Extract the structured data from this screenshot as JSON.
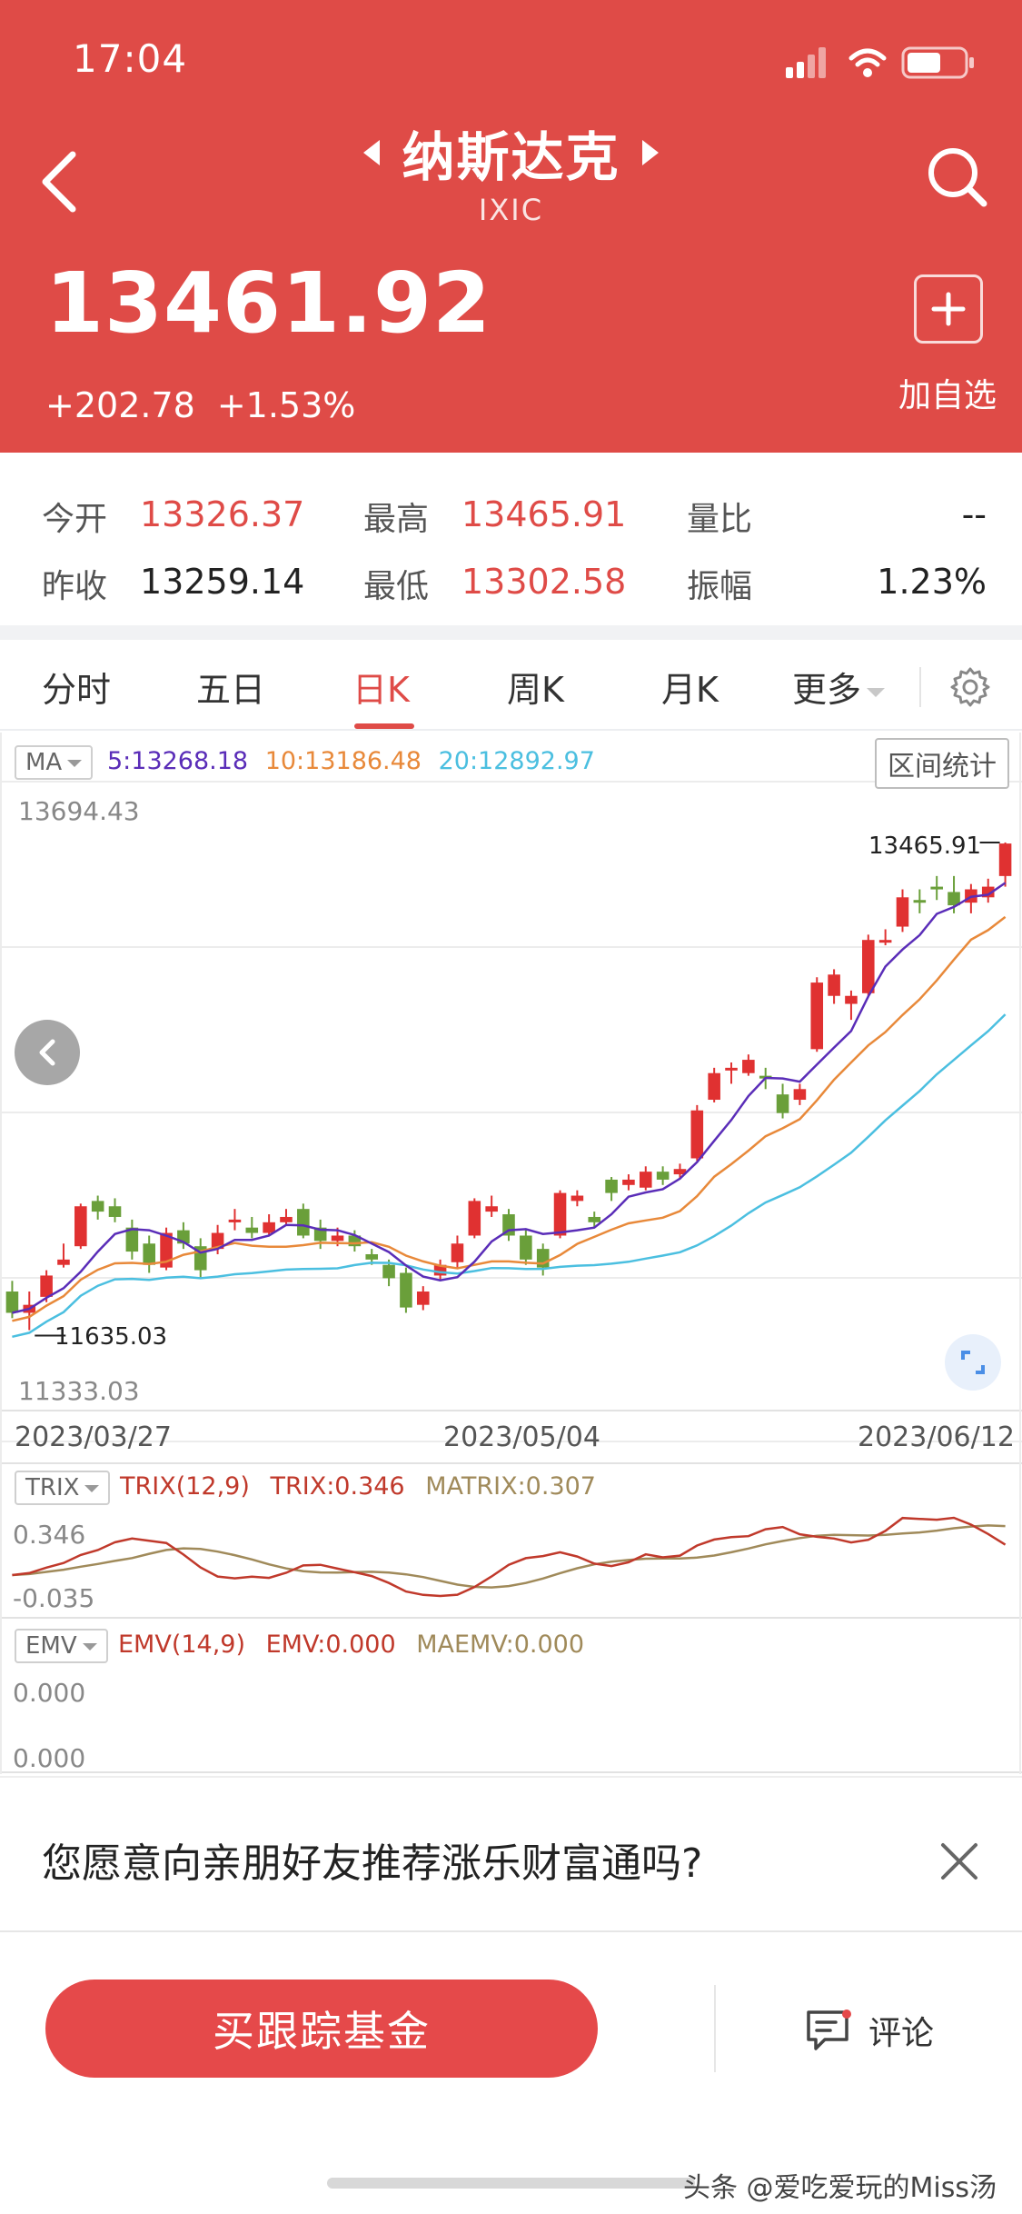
{
  "status": {
    "time": "17:04"
  },
  "header": {
    "title": "纳斯达克",
    "code": "IXIC",
    "price": "13461.92",
    "change": "+202.78",
    "change_pct": "+1.53%",
    "add_label": "加自选",
    "bg_color": "#DF4B47"
  },
  "stats": {
    "open_label": "今开",
    "open_value": "13326.37",
    "prev_close_label": "昨收",
    "prev_close_value": "13259.14",
    "high_label": "最高",
    "high_value": "13465.91",
    "low_label": "最低",
    "low_value": "13302.58",
    "vol_ratio_label": "量比",
    "vol_ratio_value": "--",
    "amplitude_label": "振幅",
    "amplitude_value": "1.23%"
  },
  "tabs": [
    {
      "label": "分时"
    },
    {
      "label": "五日"
    },
    {
      "label": "日K"
    },
    {
      "label": "周K"
    },
    {
      "label": "月K"
    },
    {
      "label": "更多"
    }
  ],
  "chart": {
    "ma_label": "MA",
    "ma5": "5:13268.18",
    "ma10": "10:13186.48",
    "ma20": "20:12892.97",
    "range_button": "区间统计",
    "y_top": "13694.43",
    "y_bottom": "11333.03",
    "high_mark": "13465.91",
    "low_mark": "11635.03",
    "dates": [
      "2023/03/27",
      "2023/05/04",
      "2023/06/12"
    ],
    "trix_box": "TRIX",
    "trix_params": "TRIX(12,9)",
    "trix_value": "TRIX:0.346",
    "matrix_value": "MATRIX:0.307",
    "trix_y_top": "0.346",
    "trix_y_bottom": "-0.035",
    "emv_box": "EMV",
    "emv_params": "EMV(14,9)",
    "emv_value": "EMV:0.000",
    "maemv_value": "MAEMV:0.000",
    "emv_y_top": "0.000",
    "emv_y_bottom": "0.000",
    "colors": {
      "up": "#E03131",
      "down": "#6A9F3A",
      "ma5": "#5A2DB8",
      "ma10": "#E8893A",
      "ma20": "#4BBFE0",
      "trix": "#C0392B",
      "matrix": "#A08A5A"
    }
  },
  "chart_data": {
    "type": "candlestick",
    "title": "",
    "ylim": [
      11333.03,
      13694.43
    ],
    "x_ticks": [
      "2023/03/27",
      "2023/05/04",
      "2023/06/12"
    ],
    "candles": [
      [
        11780,
        11700,
        11820,
        11680
      ],
      [
        11700,
        11730,
        11780,
        11635
      ],
      [
        11760,
        11840,
        11860,
        11740
      ],
      [
        11880,
        11900,
        11960,
        11870
      ],
      [
        11950,
        12100,
        12110,
        11940
      ],
      [
        12120,
        12080,
        12140,
        12050
      ],
      [
        12100,
        12060,
        12130,
        12040
      ],
      [
        12020,
        11930,
        12050,
        11900
      ],
      [
        11960,
        11880,
        11990,
        11850
      ],
      [
        11870,
        12000,
        12020,
        11860
      ],
      [
        12010,
        11960,
        12040,
        11940
      ],
      [
        11950,
        11860,
        11980,
        11830
      ],
      [
        11940,
        12000,
        12030,
        11920
      ],
      [
        12040,
        12050,
        12090,
        12010
      ],
      [
        12020,
        12000,
        12060,
        11980
      ],
      [
        12000,
        12040,
        12070,
        11990
      ],
      [
        12040,
        12060,
        12090,
        12030
      ],
      [
        12090,
        11990,
        12110,
        11980
      ],
      [
        12020,
        11970,
        12050,
        11940
      ],
      [
        11970,
        11990,
        12020,
        11950
      ],
      [
        11990,
        11950,
        12010,
        11930
      ],
      [
        11920,
        11900,
        11940,
        11880
      ],
      [
        11880,
        11830,
        11900,
        11800
      ],
      [
        11850,
        11720,
        11870,
        11700
      ],
      [
        11730,
        11780,
        11800,
        11710
      ],
      [
        11840,
        11880,
        11900,
        11820
      ],
      [
        11890,
        11960,
        11990,
        11870
      ],
      [
        11990,
        12120,
        12130,
        11980
      ],
      [
        12080,
        12100,
        12140,
        12060
      ],
      [
        12070,
        11990,
        12090,
        11970
      ],
      [
        11990,
        11900,
        12010,
        11880
      ],
      [
        11940,
        11870,
        11960,
        11840
      ],
      [
        11990,
        12150,
        12160,
        11980
      ],
      [
        12120,
        12140,
        12160,
        12100
      ],
      [
        12060,
        12040,
        12080,
        12020
      ],
      [
        12200,
        12150,
        12210,
        12120
      ],
      [
        12180,
        12200,
        12220,
        12160
      ],
      [
        12170,
        12230,
        12250,
        12160
      ],
      [
        12230,
        12200,
        12250,
        12180
      ],
      [
        12220,
        12240,
        12260,
        12200
      ],
      [
        12280,
        12460,
        12480,
        12270
      ],
      [
        12500,
        12600,
        12620,
        12490
      ],
      [
        12610,
        12620,
        12640,
        12560
      ],
      [
        12600,
        12650,
        12670,
        12590
      ],
      [
        12590,
        12580,
        12620,
        12540
      ],
      [
        12520,
        12450,
        12560,
        12430
      ],
      [
        12500,
        12540,
        12560,
        12480
      ],
      [
        12690,
        12940,
        12960,
        12680
      ],
      [
        12890,
        12970,
        12990,
        12860
      ],
      [
        12860,
        12890,
        12910,
        12800
      ],
      [
        12900,
        13100,
        13120,
        12890
      ],
      [
        13090,
        13100,
        13140,
        13080
      ],
      [
        13150,
        13260,
        13290,
        13130
      ],
      [
        13250,
        13240,
        13290,
        13200
      ],
      [
        13300,
        13290,
        13340,
        13250
      ],
      [
        13280,
        13230,
        13340,
        13200
      ],
      [
        13240,
        13290,
        13310,
        13200
      ],
      [
        13260,
        13300,
        13330,
        13240
      ],
      [
        13340,
        13462,
        13466,
        13300
      ]
    ],
    "series": [
      {
        "name": "TRIX(12,9)",
        "last": 0.346
      },
      {
        "name": "MATRIX",
        "last": 0.307
      }
    ]
  },
  "survey": {
    "text": "您愿意向亲朋好友推荐涨乐财富通吗?"
  },
  "bottom": {
    "buy_label": "买跟踪基金",
    "comment_label": "评论",
    "watermark": "头条 @爱吃爱玩的Miss汤"
  }
}
